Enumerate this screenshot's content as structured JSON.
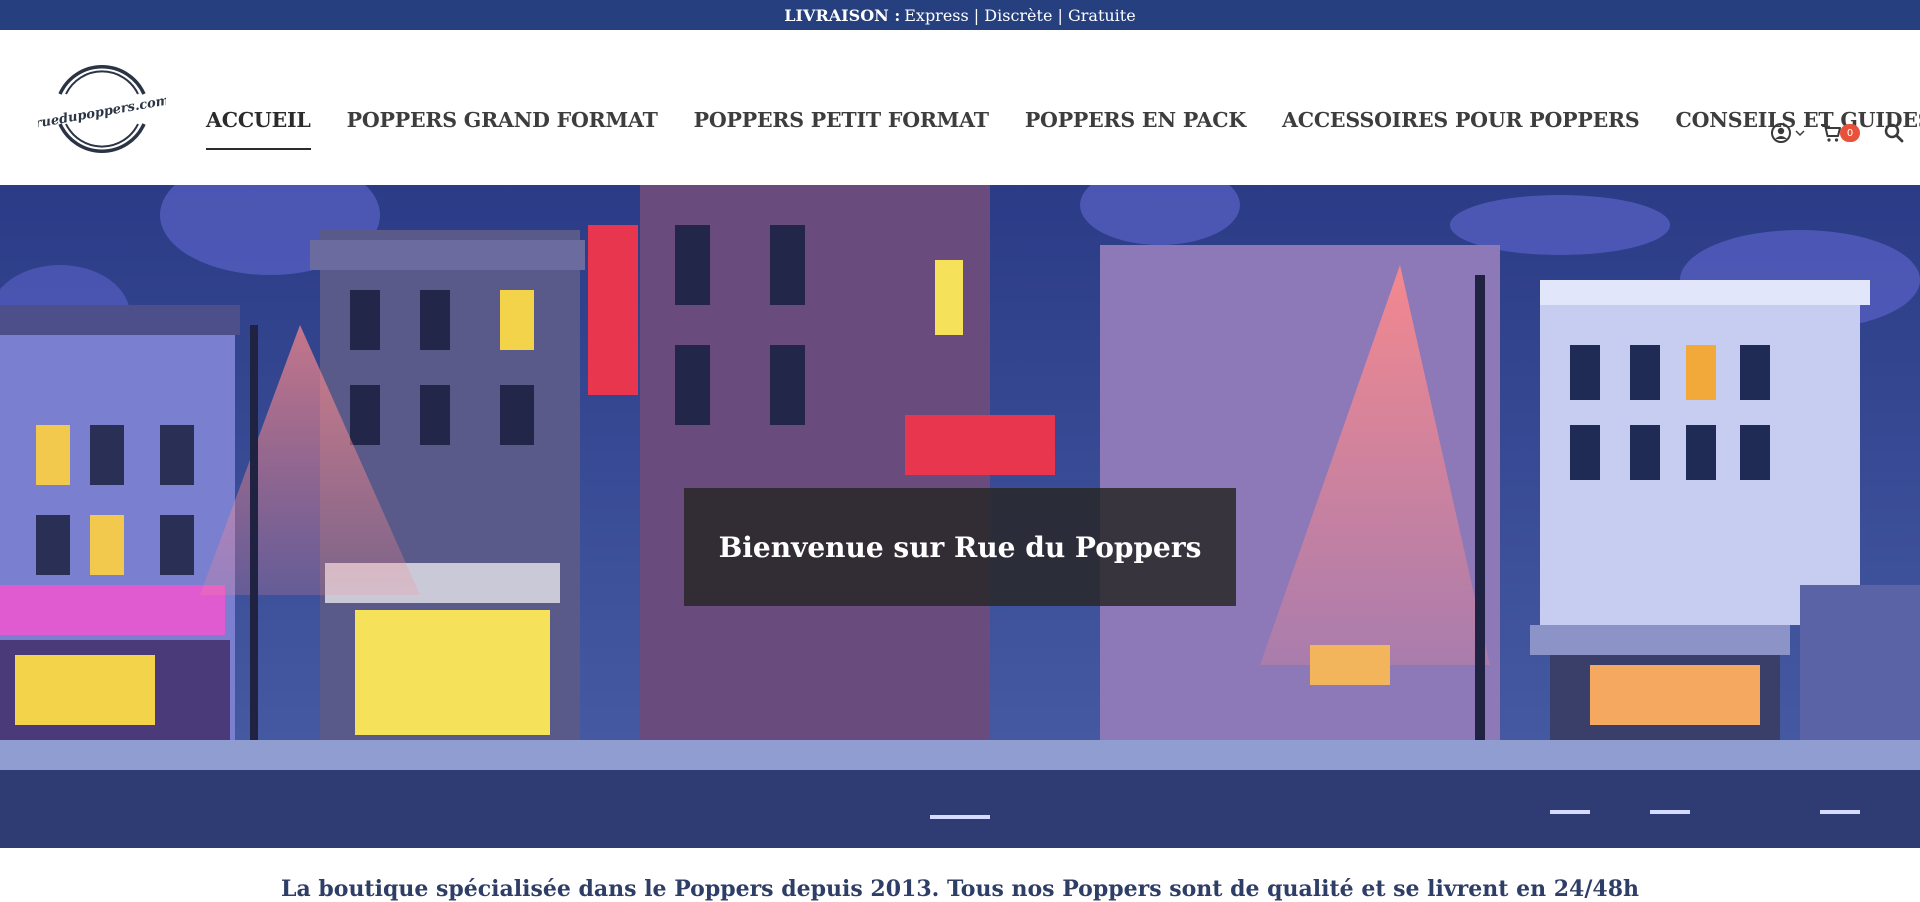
{
  "topbar": {
    "label": "LIVRAISON :",
    "text": "Express | Discrète | Gratuite"
  },
  "logo": {
    "text": "ruedupoppers.com"
  },
  "nav": {
    "items": [
      {
        "label": "ACCUEIL",
        "active": true
      },
      {
        "label": "POPPERS GRAND FORMAT"
      },
      {
        "label": "POPPERS PETIT FORMAT"
      },
      {
        "label": "POPPERS EN PACK"
      },
      {
        "label": "ACCESSOIRES POUR POPPERS"
      },
      {
        "label": "CONSEILS ET GUIDES"
      }
    ]
  },
  "header_icons": {
    "account": "user-circle-icon",
    "cart": "cart-icon",
    "cart_count": "0",
    "search": "search-icon"
  },
  "hero": {
    "title": "Bienvenue sur Rue du Poppers"
  },
  "intro": {
    "text": "La boutique spécialisée dans le Poppers depuis 2013. Tous nos Poppers sont de qualité et se livrent en 24/48h"
  },
  "colors": {
    "topbar": "#253f7f",
    "badge": "#e8523a",
    "nav_text": "#3d3d3d"
  }
}
